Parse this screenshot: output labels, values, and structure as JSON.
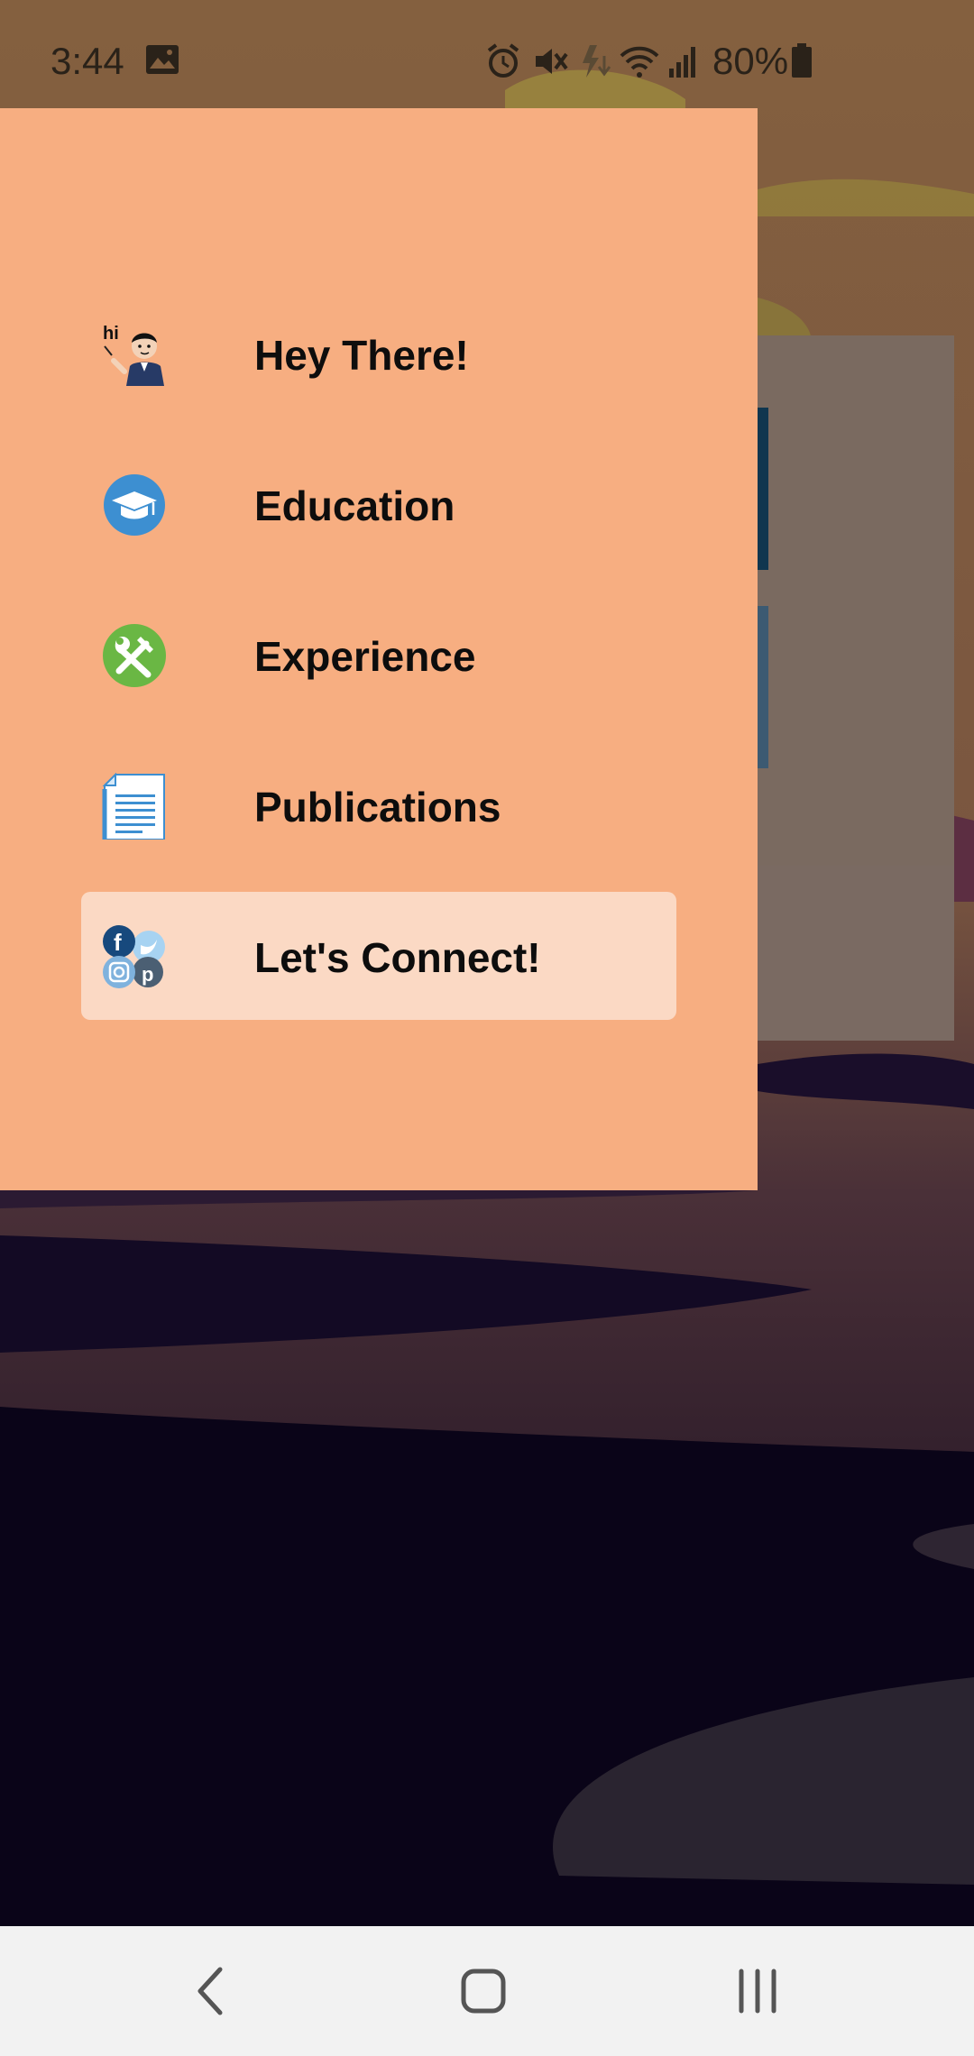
{
  "status_bar": {
    "time": "3:44",
    "battery": "80%",
    "icons": [
      "image-icon",
      "alarm-icon",
      "vibrate-mute-icon",
      "data-saver-icon",
      "wifi-icon",
      "signal-icon",
      "battery-icon"
    ]
  },
  "drawer": {
    "items": [
      {
        "label": "Hey There!",
        "icon": "avatar-hi-icon",
        "active": false
      },
      {
        "label": "Education",
        "icon": "graduation-cap-icon",
        "active": false
      },
      {
        "label": "Experience",
        "icon": "tools-icon",
        "active": false
      },
      {
        "label": "Publications",
        "icon": "document-icon",
        "active": false
      },
      {
        "label": "Let's Connect!",
        "icon": "social-media-icon",
        "active": true
      }
    ],
    "background_color": "#f7ae81",
    "active_item_color": "#fbd9c4"
  },
  "nav_bar": {
    "buttons": [
      "back-icon",
      "home-icon",
      "recents-icon"
    ]
  },
  "colors": {
    "scrim": "#7a6a60",
    "night": "#0a0418",
    "nav_bg": "#f2f2f2"
  }
}
